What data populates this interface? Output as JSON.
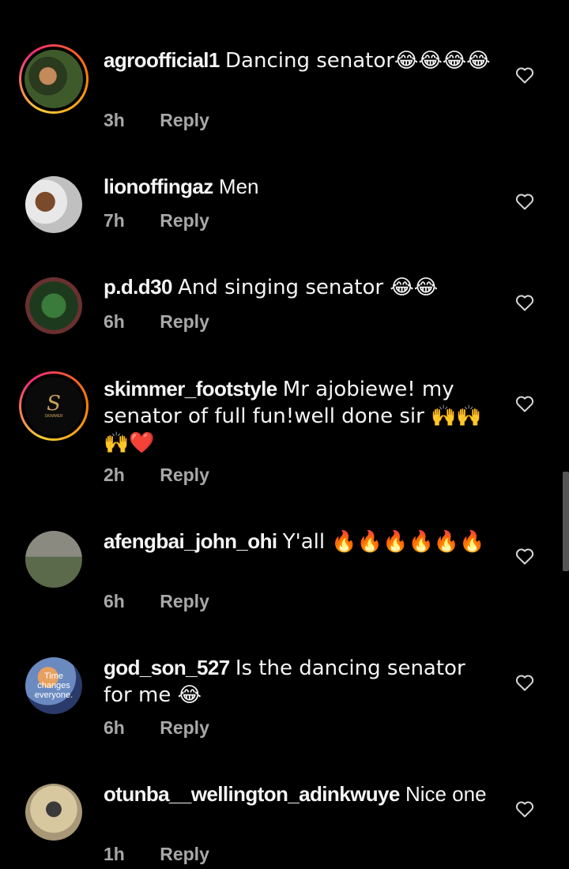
{
  "comments": [
    {
      "username": "agroofficial1",
      "text": "Dancing senator😂😂😂😂",
      "time": "3h",
      "reply": "Reply"
    },
    {
      "username": "lionoffingaz",
      "text": "Men",
      "time": "7h",
      "reply": "Reply"
    },
    {
      "username": "p.d.d30",
      "text": "And singing senator 😂😂",
      "time": "6h",
      "reply": "Reply"
    },
    {
      "username": "skimmer_footstyle",
      "text": "Mr ajobiewe! my senator of full fun!well done sir 🙌🙌🙌❤️",
      "time": "2h",
      "reply": "Reply",
      "avatar_text": "SKIMMER"
    },
    {
      "username": "afengbai_john_ohi",
      "text": "Y'all 🔥🔥🔥🔥🔥🔥",
      "time": "6h",
      "reply": "Reply"
    },
    {
      "username": "god_son_527",
      "text": "Is the dancing senator for me 😂",
      "time": "6h",
      "reply": "Reply",
      "avatar_text": "Time changes everyone."
    },
    {
      "username": "otunba__wellington_adinkwuye",
      "text": "Nice one",
      "time": "1h",
      "reply": "Reply"
    }
  ],
  "colors": {
    "background": "#000000",
    "secondary_text": "#a8a8a8",
    "heart_outline": "#d8d8d8"
  }
}
